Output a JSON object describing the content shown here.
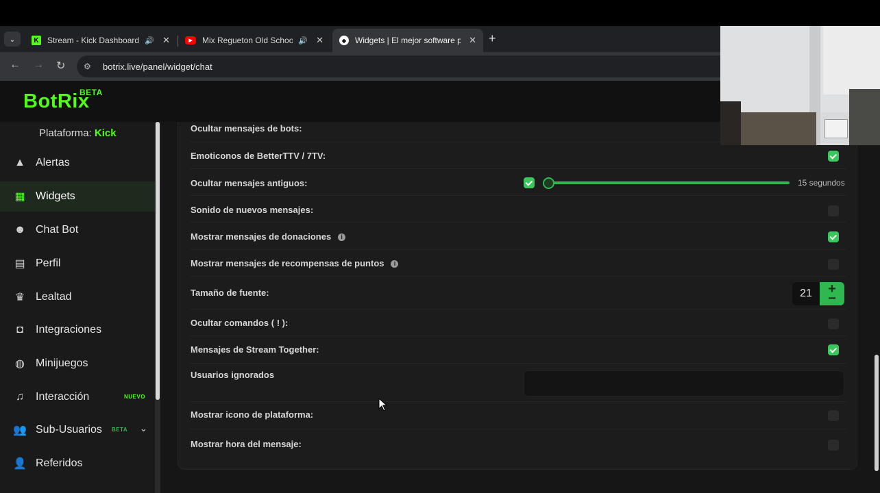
{
  "browser": {
    "tabs": [
      {
        "title": "Stream - Kick Dashboard",
        "icon": "kick-icon",
        "audio": true
      },
      {
        "title": "Mix Regueton Old School D",
        "icon": "youtube-icon",
        "audio": true
      },
      {
        "title": "Widgets | El mejor software par",
        "icon": "botrix-icon",
        "audio": false
      }
    ],
    "url": "botrix.live/panel/widget/chat"
  },
  "app": {
    "logo": "BotRix",
    "logo_badge": "BETA",
    "platform_label": "Plataforma:",
    "platform_value": "Kick",
    "accent": "#53fc18",
    "sidebar": [
      {
        "label": "Alertas",
        "icon": "warning-icon"
      },
      {
        "label": "Widgets",
        "icon": "widgets-icon",
        "active": true
      },
      {
        "label": "Chat Bot",
        "icon": "robot-icon"
      },
      {
        "label": "Perfil",
        "icon": "id-card-icon"
      },
      {
        "label": "Lealtad",
        "icon": "trophy-icon"
      },
      {
        "label": "Integraciones",
        "icon": "discord-icon"
      },
      {
        "label": "Minijuegos",
        "icon": "gamepad-icon"
      },
      {
        "label": "Interacción",
        "icon": "music-icon",
        "badge": "NUEVO"
      },
      {
        "label": "Sub-Usuarios",
        "icon": "users-icon",
        "badge": "BETA"
      },
      {
        "label": "Referidos",
        "icon": "user-friends-icon"
      }
    ]
  },
  "settings": {
    "hide_bots": {
      "label": "Ocultar mensajes de bots:"
    },
    "bttv": {
      "label": "Emoticonos de BetterTTV / 7TV:",
      "checked": true
    },
    "hide_old": {
      "label": "Ocultar mensajes antiguos:",
      "checked": true,
      "value": 15,
      "value_text": "15 segundos"
    },
    "sound": {
      "label": "Sonido de nuevos mensajes:",
      "checked": false
    },
    "donations": {
      "label": "Mostrar mensajes de donaciones",
      "checked": true
    },
    "rewards": {
      "label": "Mostrar mensajes de recompensas de puntos",
      "checked": false
    },
    "font_size": {
      "label": "Tamaño de fuente:",
      "value": "21",
      "plus": "+",
      "minus": "−"
    },
    "hide_commands": {
      "label": "Ocultar comandos ( ! ):",
      "checked": false
    },
    "stream_together": {
      "label": "Mensajes de Stream Together:",
      "checked": true
    },
    "ignored_users": {
      "label": "Usuarios ignorados",
      "value": ""
    },
    "platform_icon": {
      "label": "Mostrar icono de plataforma:",
      "checked": false
    },
    "message_time": {
      "label": "Mostrar hora del mensaje:",
      "checked": false
    }
  }
}
